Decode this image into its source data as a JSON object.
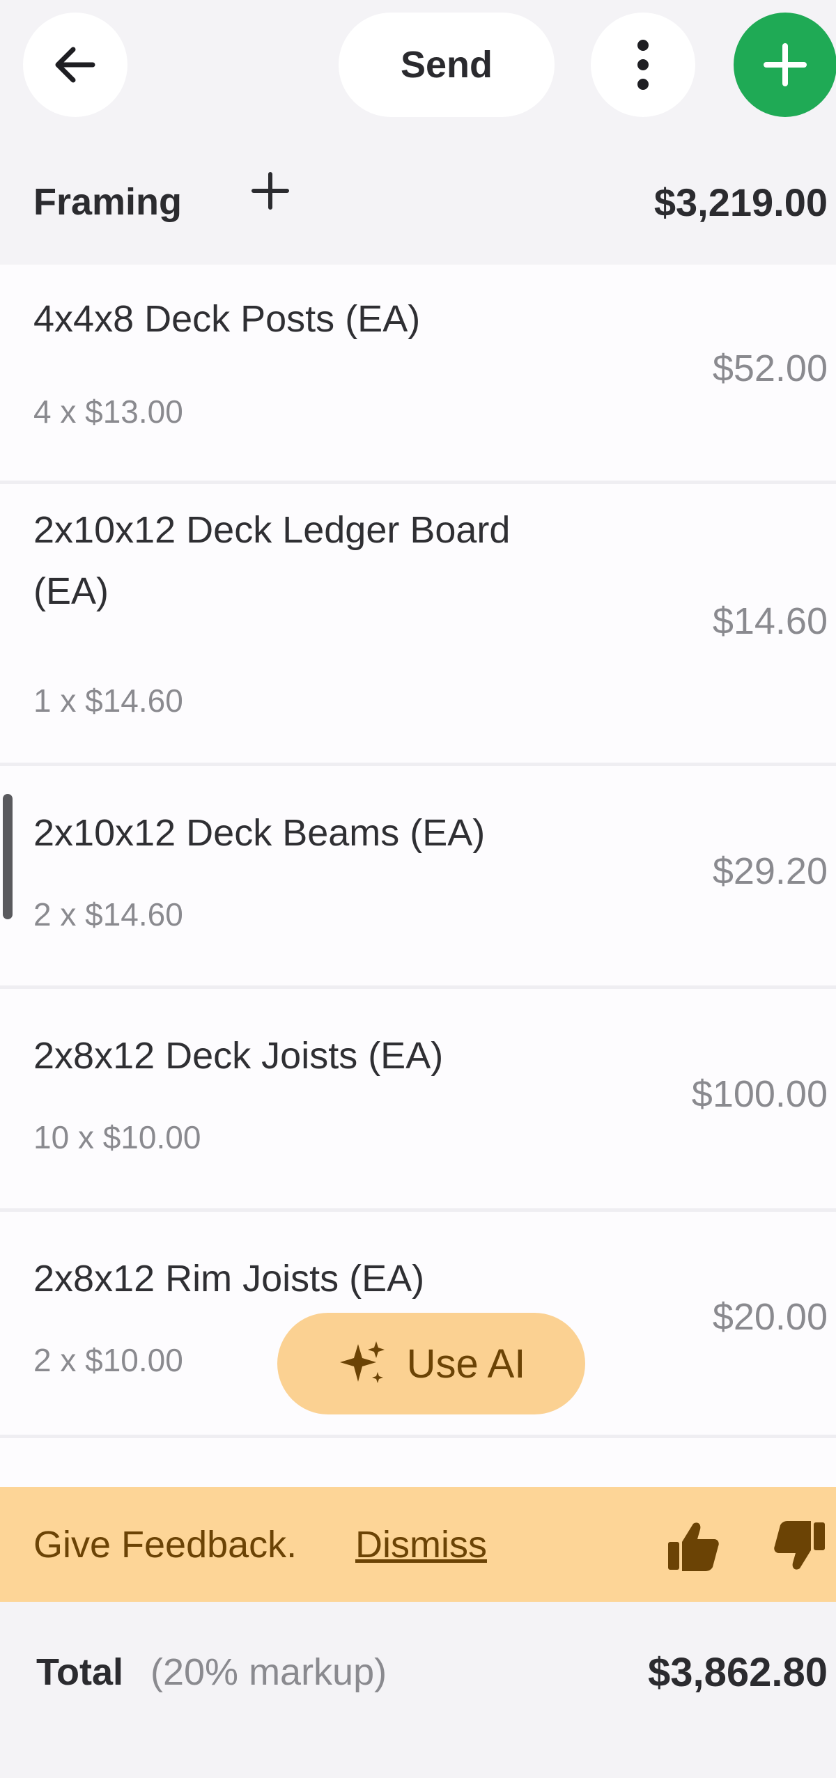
{
  "header": {
    "send_label": "Send",
    "icons": {
      "back": "arrow-left-icon",
      "more": "kebab-icon",
      "add": "plus-icon"
    },
    "accent_color": "#1faa55"
  },
  "section": {
    "title": "Framing",
    "total": "$3,219.00"
  },
  "items": [
    {
      "name": "4x4x8 Deck Posts (EA)",
      "qty": "4 x $13.00",
      "price": "$52.00"
    },
    {
      "name": "2x10x12 Deck Ledger Board (EA)",
      "qty": "1 x $14.60",
      "price": "$14.60"
    },
    {
      "name": "2x10x12 Deck Beams (EA)",
      "qty": "2 x $14.60",
      "price": "$29.20"
    },
    {
      "name": "2x8x12 Deck Joists (EA)",
      "qty": "10 x $10.00",
      "price": "$100.00"
    },
    {
      "name": "2x8x12 Rim Joists (EA)",
      "qty": "2 x $10.00",
      "price": "$20.00"
    }
  ],
  "ai_button": {
    "label": "Use AI"
  },
  "feedback": {
    "text": "Give Feedback.",
    "dismiss": "Dismiss",
    "color": "#fdd597"
  },
  "footer": {
    "label": "Total",
    "markup": "(20% markup)",
    "total": "$3,862.80"
  }
}
